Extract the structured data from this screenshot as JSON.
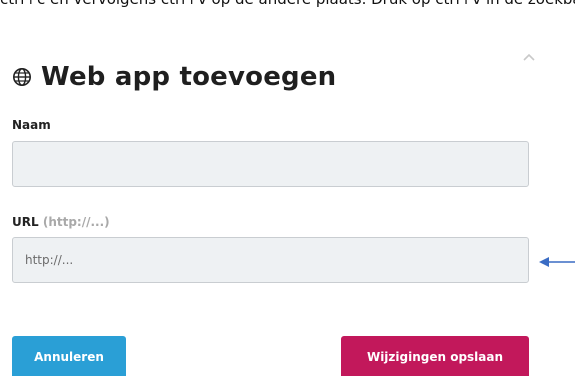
{
  "top_text": "ctrl+c en vervolgens ctrl+v op de andere plaats. Druk op ctrl+v in de zoekbalk en druk op Enter. Zet er vervolgens een andere ctrl+v op de onderste bouwsteen",
  "dialog": {
    "title": "Web app toevoegen",
    "name_label": "Naam",
    "name_value": "",
    "url_label": "URL",
    "url_hint": "(http://...)",
    "url_placeholder": "http://..."
  },
  "buttons": {
    "cancel_label": "Annuleren",
    "save_label": "Wijzigingen opslaan"
  },
  "colors": {
    "cancel": "#2a9fd6",
    "save": "#c2185b",
    "arrow": "#3a6cc4"
  },
  "icons": {
    "title": "globe-icon",
    "collapse": "chevron-up-icon",
    "annotation": "arrow-left-icon"
  }
}
